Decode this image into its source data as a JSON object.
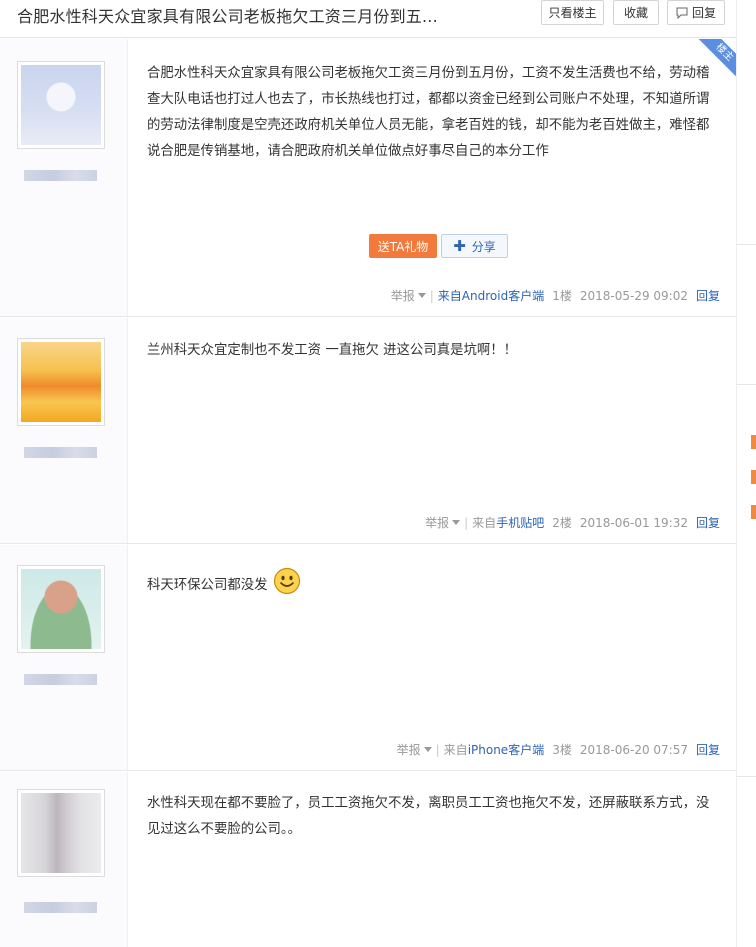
{
  "header": {
    "title": "合肥水性科天众宜家具有限公司老板拖欠工资三月份到五...",
    "only_author": "只看楼主",
    "favorite": "收藏",
    "reply": "回复"
  },
  "posts": [
    {
      "badge": "楼主",
      "content": "合肥水性科天众宜家具有限公司老板拖欠工资三月份到五月份，工资不发生活费也不给，劳动稽查大队电话也打过人也去了，市长热线也打过，都都以资金已经到公司账户不处理，不知道所谓的劳动法律制度是空壳还政府机关单位人员无能，拿老百姓的钱，却不能为老百姓做主，难怪都说合肥是传销基地，请合肥政府机关单位做点好事尽自己的本分工作",
      "gift": "送TA礼物",
      "share": "分享",
      "report": "举报",
      "source": "来自Android客户端",
      "floor": "1楼",
      "date": "2018-05-29 09:02",
      "reply": "回复"
    },
    {
      "content": "兰州科天众宜定制也不发工资 一直拖欠 进这公司真是坑啊！！",
      "report": "举报",
      "source_prefix": "来自",
      "source": "手机贴吧",
      "floor": "2楼",
      "date": "2018-06-01 19:32",
      "reply": "回复"
    },
    {
      "content": "科天环保公司都没发",
      "report": "举报",
      "source_prefix": "来自",
      "source": "iPhone客户端",
      "floor": "3楼",
      "date": "2018-06-20 07:57",
      "reply": "回复"
    },
    {
      "content": "水性科天现在都不要脸了，员工工资拖欠不发，离职员工工资也拖欠不发，还屏蔽联系方式，没见过这么不要脸的公司。。"
    }
  ],
  "colors": {
    "link": "#2d64b3",
    "gift": "#f27a3c",
    "badge": "#5b8de0",
    "muted": "#999999"
  }
}
